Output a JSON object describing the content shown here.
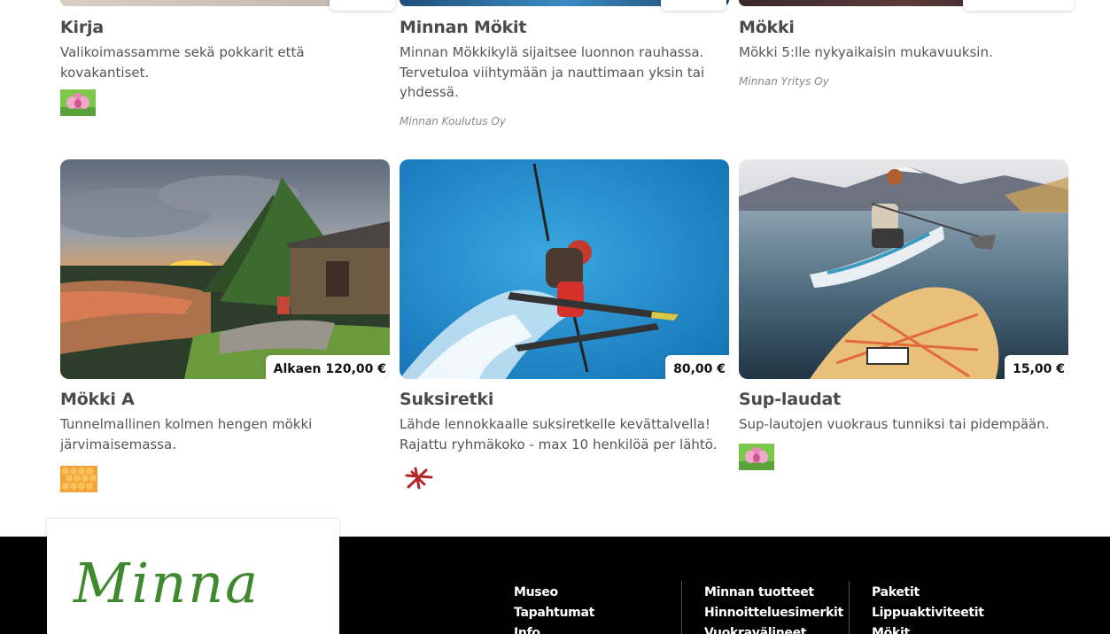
{
  "top_row": [
    {
      "title": "Kirja",
      "description": "Valikoimassamme sekä pokkarit että kovakantiset.",
      "vendor": "",
      "logo": "flower-logo"
    },
    {
      "title": "Minnan Mökit",
      "description": "Minnan Mökkikylä sijaitsee luonnon rauhassa. Tervetuloa viihtymään ja nauttimaan yksin tai yhdessä.",
      "vendor": "Minnan Koulutus Oy",
      "logo": ""
    },
    {
      "title": "Mökki",
      "description": "Mökki 5:lle nykyaikaisin mukavuuksin.",
      "vendor": "Minnan Yritys Oy",
      "logo": ""
    }
  ],
  "products": [
    {
      "title": "Mökki A",
      "price": "Alkaen 120,00 €",
      "description": "Tunnelmallinen kolmen hengen mökki järvimaisemassa.",
      "logo": "orange-pattern-logo",
      "image": "sunset-cabin-photo"
    },
    {
      "title": "Suksiretki",
      "price": "80,00 €",
      "description": "Lähde lennokkaalle suksiretkelle kevättalvella! Rajattu ryhmäkoko - max 10 henkilöä per lähtö.",
      "logo": "red-star-logo",
      "image": "skier-jump-photo"
    },
    {
      "title": "Sup-laudat",
      "price": "15,00 €",
      "description": "Sup-lautojen vuokraus tunniksi tai pidempään.",
      "logo": "flower-logo",
      "image": "paddleboard-photo"
    }
  ],
  "footer": {
    "brand": "Minna",
    "col1": [
      "Museo",
      "Tapahtumat",
      "Info"
    ],
    "col2": [
      "Minnan tuotteet",
      "Hinnoitteluesimerkit",
      "Vuokravälineet"
    ],
    "col3": [
      "Paketit",
      "Lippuaktiviteetit",
      "Mökit"
    ]
  },
  "colors": {
    "brand_green": "#3f8a2e",
    "footer_bg": "#000000"
  }
}
